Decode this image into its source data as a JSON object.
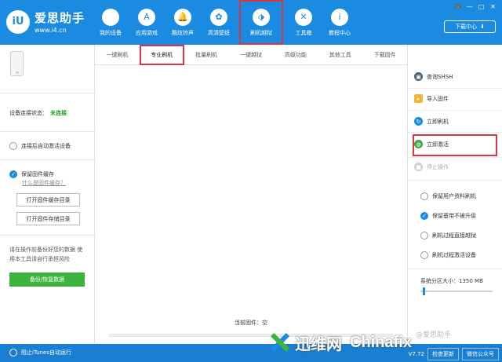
{
  "app": {
    "name": "爱思助手",
    "url": "www.i4.cn",
    "logo_mark": "iU"
  },
  "nav": [
    {
      "label": "我的设备",
      "icon": "apple-icon",
      "glyph": ""
    },
    {
      "label": "应用游戏",
      "icon": "app-store-icon",
      "glyph": "A"
    },
    {
      "label": "酷炫铃声",
      "icon": "bell-icon",
      "glyph": "🔔"
    },
    {
      "label": "高清壁纸",
      "icon": "flower-icon",
      "glyph": "✿"
    },
    {
      "label": "刷机越狱",
      "icon": "dropbox-icon",
      "glyph": "⬗",
      "active": true
    },
    {
      "label": "工具箱",
      "icon": "tools-icon",
      "glyph": "✕"
    },
    {
      "label": "教程中心",
      "icon": "info-icon",
      "glyph": "i"
    }
  ],
  "window_controls": [
    "🎮",
    "—",
    "□",
    "✕"
  ],
  "download_center": {
    "label": "下载中心",
    "icon": "download-icon"
  },
  "tabs": [
    "一键刷机",
    "专业刷机",
    "批量刷机",
    "一键越狱",
    "高级功能",
    "其他工具",
    "下载固件"
  ],
  "active_tab": 1,
  "left": {
    "connection_label": "设备连接状态：",
    "connection_status": "未连接",
    "auto_activate": "连接后自动激活设备",
    "keep_cache": "保留固件缓存",
    "what_is_cache": "什么是固件缓存？",
    "open_cache_dir": "打开固件缓存目录",
    "open_store_dir": "打开固件存储目录",
    "warning": "请在操作前备份好您的数据 使用本工具请自行承担风险",
    "backup_button": "备份/恢复数据"
  },
  "center": {
    "current_firmware": "当前固件：空"
  },
  "right": {
    "actions": [
      {
        "label": "查询SHSH",
        "icon": "shsh-icon"
      },
      {
        "label": "导入固件",
        "icon": "folder-icon"
      },
      {
        "label": "立即刷机",
        "icon": "flash-icon"
      },
      {
        "label": "立即激活",
        "icon": "globe-icon",
        "highlighted": true
      },
      {
        "label": "停止操作",
        "icon": "stop-icon",
        "disabled": true
      }
    ],
    "options": [
      {
        "label": "保留用户资料刷机",
        "checked": false
      },
      {
        "label": "保留基带不被升级",
        "checked": true
      },
      {
        "label": "刷机过程直接越狱",
        "checked": false
      },
      {
        "label": "刷机过程激活设备",
        "checked": false
      }
    ],
    "partition_label": "系统分区大小：",
    "partition_value": "1350 MB"
  },
  "bottom": {
    "itunes": "阻止iTunes自动运行",
    "version": "V7.72",
    "check_update": "检查更新",
    "wechat": "微信公众号"
  },
  "watermark": {
    "cn": "迅维网",
    "en": "Chinafix",
    "ai": "@爱思助手"
  },
  "colors": {
    "primary": "#1a8be0",
    "highlight": "#d9363e",
    "success": "#3db43d"
  }
}
